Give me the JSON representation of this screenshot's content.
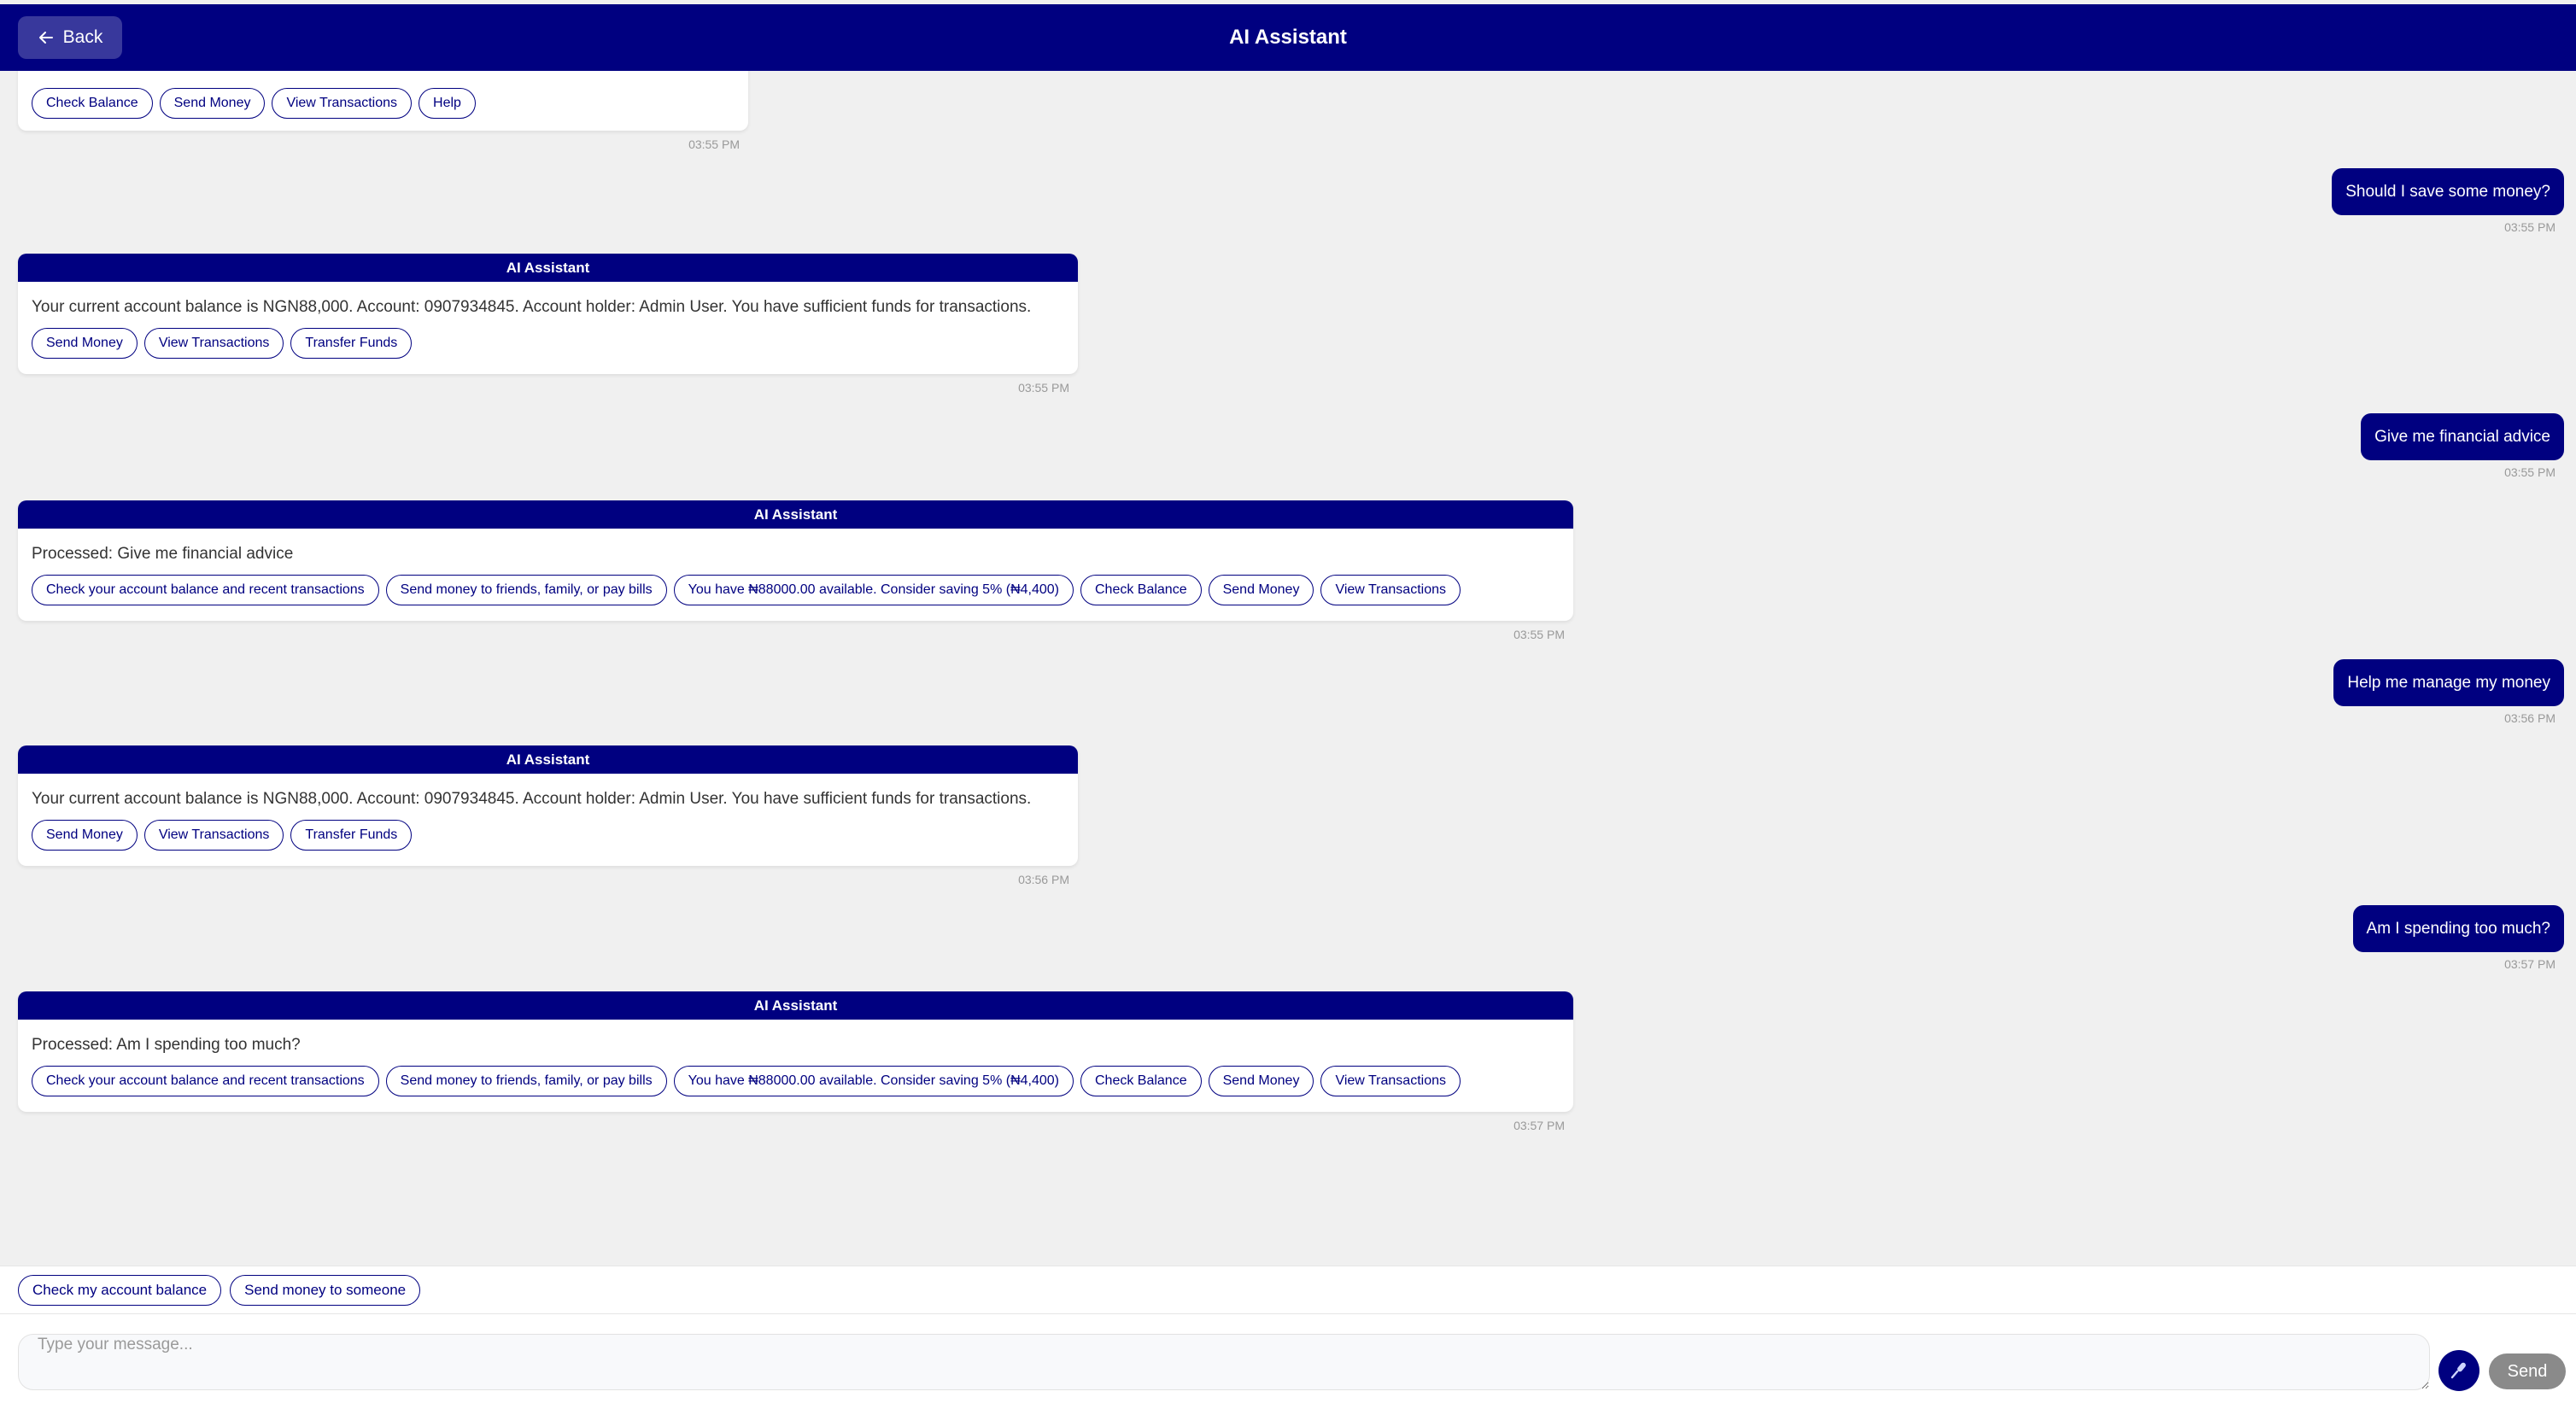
{
  "header": {
    "title": "AI Assistant",
    "back_label": "Back"
  },
  "bot_label": "AI Assistant",
  "messages": {
    "m0": {
      "chips": [
        "Check Balance",
        "Send Money",
        "View Transactions",
        "Help"
      ],
      "time": "03:55 PM"
    },
    "u1": {
      "text": "Should I save some money?",
      "time": "03:55 PM"
    },
    "m1": {
      "text": "Your current account balance is NGN88,000. Account: 0907934845. Account holder: Admin User. You have sufficient funds for transactions.",
      "chips": [
        "Send Money",
        "View Transactions",
        "Transfer Funds"
      ],
      "time": "03:55 PM"
    },
    "u2": {
      "text": "Give me financial advice",
      "time": "03:55 PM"
    },
    "m2": {
      "text": "Processed: Give me financial advice",
      "chips": [
        "Check your account balance and recent transactions",
        "Send money to friends, family, or pay bills",
        "You have ₦88000.00 available. Consider saving 5% (₦4,400)",
        "Check Balance",
        "Send Money",
        "View Transactions"
      ],
      "time": "03:55 PM"
    },
    "u3": {
      "text": "Help me manage my money",
      "time": "03:56 PM"
    },
    "m3": {
      "text": "Your current account balance is NGN88,000. Account: 0907934845. Account holder: Admin User. You have sufficient funds for transactions.",
      "chips": [
        "Send Money",
        "View Transactions",
        "Transfer Funds"
      ],
      "time": "03:56 PM"
    },
    "u4": {
      "text": "Am I spending too much?",
      "time": "03:57 PM"
    },
    "m4": {
      "text": "Processed: Am I spending too much?",
      "chips": [
        "Check your account balance and recent transactions",
        "Send money to friends, family, or pay bills",
        "You have ₦88000.00 available. Consider saving 5% (₦4,400)",
        "Check Balance",
        "Send Money",
        "View Transactions"
      ],
      "time": "03:57 PM"
    }
  },
  "quick_replies": [
    "Check my account balance",
    "Send money to someone"
  ],
  "composer": {
    "placeholder": "Type your message...",
    "send_label": "Send"
  },
  "icons": {
    "back": "arrow-left-icon",
    "mic": "microphone-icon"
  },
  "colors": {
    "primary": "#000080",
    "background": "#f0f0f0",
    "send_disabled": "#8a8a8a"
  }
}
